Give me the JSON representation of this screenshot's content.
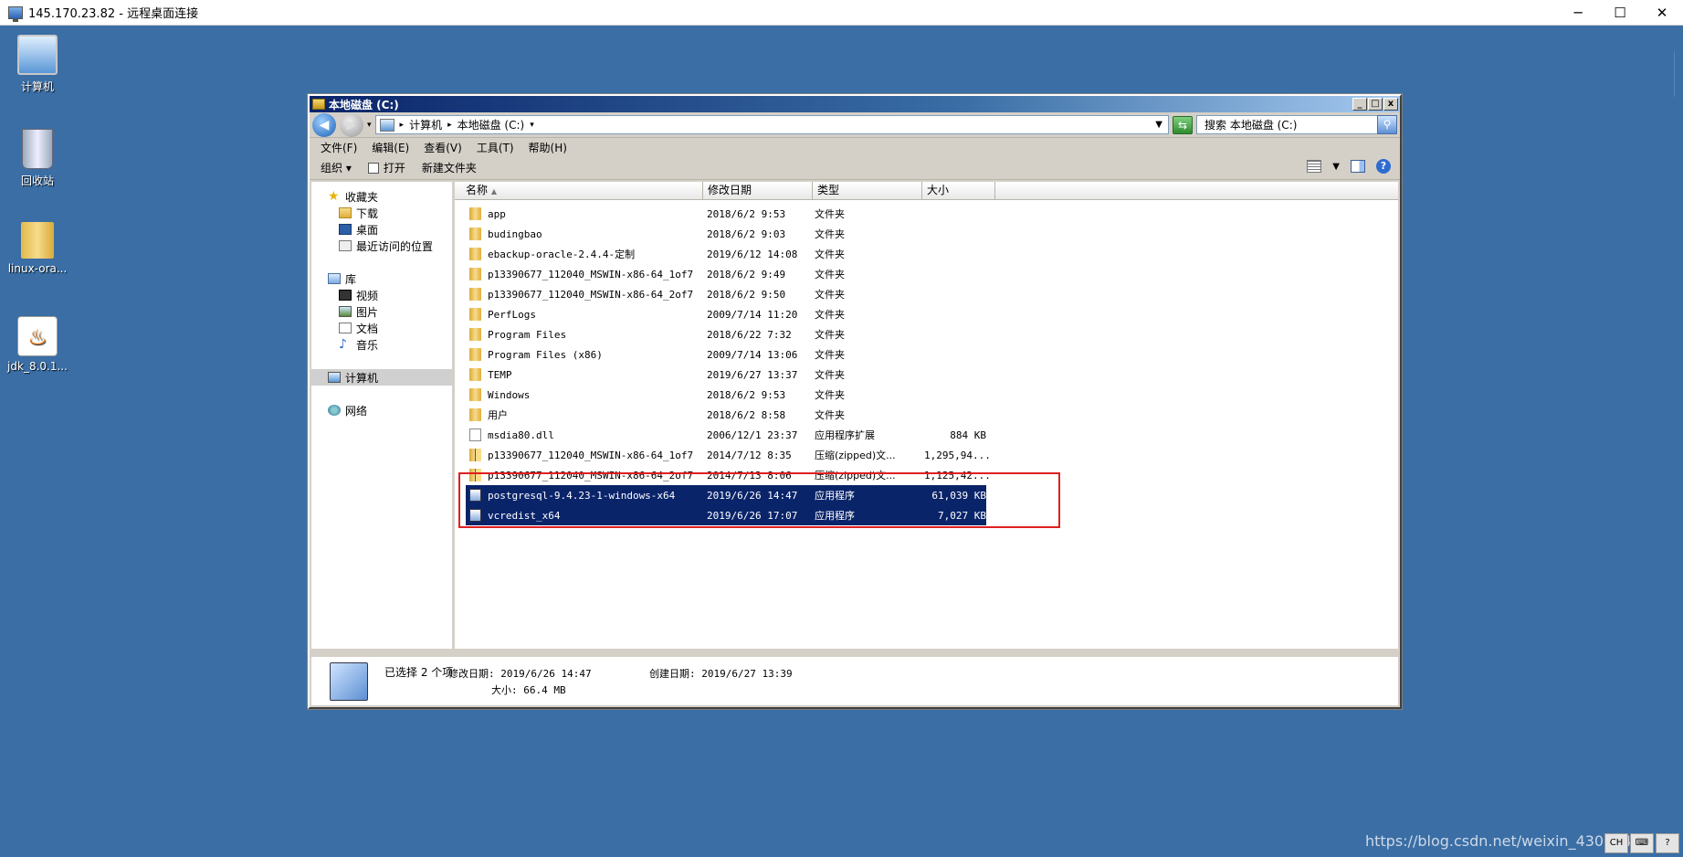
{
  "rdp": {
    "title": "145.170.23.82 - 远程桌面连接",
    "min": "─",
    "max": "☐",
    "close": "✕"
  },
  "desktop_icons": [
    {
      "label": "计算机",
      "icon": "computer-icon"
    },
    {
      "label": "回收站",
      "icon": "recycle-bin-icon"
    },
    {
      "label": "linux-ora...",
      "icon": "folder-icon"
    },
    {
      "label": "jdk_8.0.1...",
      "icon": "java-icon"
    }
  ],
  "window": {
    "title": "本地磁盘 (C:)",
    "min": "_",
    "max": "□",
    "close": "x"
  },
  "address": {
    "crumbs": [
      "计算机",
      "本地磁盘 (C:)"
    ],
    "search_placeholder": "搜索 本地磁盘 (C:)"
  },
  "menu": [
    "文件(F)",
    "编辑(E)",
    "查看(V)",
    "工具(T)",
    "帮助(H)"
  ],
  "toolbar": {
    "organize": "组织 ▾",
    "open": "打开",
    "new_folder": "新建文件夹"
  },
  "nav": {
    "favorites": "收藏夹",
    "downloads": "下载",
    "desktop": "桌面",
    "recent": "最近访问的位置",
    "libraries": "库",
    "videos": "视频",
    "pictures": "图片",
    "documents": "文档",
    "music": "音乐",
    "computer": "计算机",
    "network": "网络"
  },
  "columns": [
    "名称",
    "修改日期",
    "类型",
    "大小"
  ],
  "files": [
    {
      "name": "app",
      "date": "2018/6/2 9:53",
      "type": "文件夹",
      "size": "",
      "icon": "folder"
    },
    {
      "name": "budingbao",
      "date": "2018/6/2 9:03",
      "type": "文件夹",
      "size": "",
      "icon": "folder"
    },
    {
      "name": "ebackup-oracle-2.4.4-定制",
      "date": "2019/6/12 14:08",
      "type": "文件夹",
      "size": "",
      "icon": "folder"
    },
    {
      "name": "p13390677_112040_MSWIN-x86-64_1of7",
      "date": "2018/6/2 9:49",
      "type": "文件夹",
      "size": "",
      "icon": "folder"
    },
    {
      "name": "p13390677_112040_MSWIN-x86-64_2of7",
      "date": "2018/6/2 9:50",
      "type": "文件夹",
      "size": "",
      "icon": "folder"
    },
    {
      "name": "PerfLogs",
      "date": "2009/7/14 11:20",
      "type": "文件夹",
      "size": "",
      "icon": "folder"
    },
    {
      "name": "Program Files",
      "date": "2018/6/22 7:32",
      "type": "文件夹",
      "size": "",
      "icon": "folder"
    },
    {
      "name": "Program Files (x86)",
      "date": "2009/7/14 13:06",
      "type": "文件夹",
      "size": "",
      "icon": "folder"
    },
    {
      "name": "TEMP",
      "date": "2019/6/27 13:37",
      "type": "文件夹",
      "size": "",
      "icon": "folder"
    },
    {
      "name": "Windows",
      "date": "2018/6/2 9:53",
      "type": "文件夹",
      "size": "",
      "icon": "folder"
    },
    {
      "name": "用户",
      "date": "2018/6/2 8:58",
      "type": "文件夹",
      "size": "",
      "icon": "folder"
    },
    {
      "name": "msdia80.dll",
      "date": "2006/12/1 23:37",
      "type": "应用程序扩展",
      "size": "884 KB",
      "icon": "dll"
    },
    {
      "name": "p13390677_112040_MSWIN-x86-64_1of7",
      "date": "2014/7/12 8:35",
      "type": "压缩(zipped)文...",
      "size": "1,295,94...",
      "icon": "zip"
    },
    {
      "name": "p13390677_112040_MSWIN-x86-64_2of7",
      "date": "2014/7/13 8:06",
      "type": "压缩(zipped)文...",
      "size": "1,125,42...",
      "icon": "zip"
    },
    {
      "name": "postgresql-9.4.23-1-windows-x64",
      "date": "2019/6/26 14:47",
      "type": "应用程序",
      "size": "61,039 KB",
      "icon": "exe",
      "selected": true
    },
    {
      "name": "vcredist_x64",
      "date": "2019/6/26 17:07",
      "type": "应用程序",
      "size": "7,027 KB",
      "icon": "exe",
      "selected": true
    }
  ],
  "details": {
    "count": "已选择 2 个项",
    "modified": "修改日期: 2019/6/26 14:47",
    "created": "创建日期: 2019/6/27 13:39",
    "size": "大小: 66.4 MB"
  },
  "watermark": "https://blog.csdn.net/weixin_43084474",
  "tray": [
    "CH",
    "",
    "?"
  ],
  "colors": {
    "desktop": "#3a6ea5",
    "selection": "#0a246a",
    "highlight_box": "#e02020"
  }
}
